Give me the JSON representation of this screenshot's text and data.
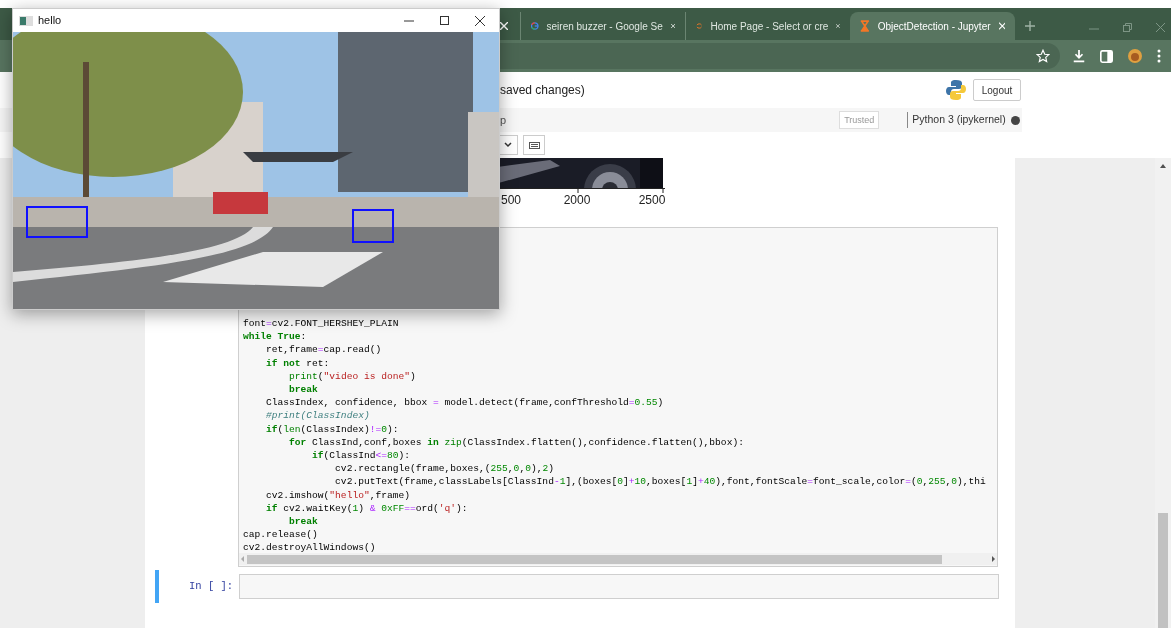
{
  "browser": {
    "tabs": [
      {
        "selected": false
      },
      {
        "title": "seiren buzzer - Google Se",
        "selected": false
      },
      {
        "title": "Home Page - Select or cre",
        "selected": false
      },
      {
        "title": "ObjectDetection - Jupyter",
        "selected": true
      }
    ]
  },
  "notebook": {
    "header_status": "saved changes)",
    "logout": "Logout",
    "menu_fragment": "p",
    "trusted": "Trusted",
    "kernel": "Python 3 (ipykernel)",
    "kernel_busy": true,
    "output_plot": {
      "tick_labels": [
        "500",
        "2000",
        "2500"
      ]
    },
    "code_cell": {
      "lines": [
        [
          {
            "kind": "plain",
            "text": "font"
          },
          {
            "kind": "operator",
            "text": "="
          },
          {
            "kind": "plain",
            "text": "cv2.FONT_HERSHEY_PLAIN"
          }
        ],
        [
          {
            "kind": "keyword",
            "text": "while True"
          },
          {
            "kind": "plain",
            "text": ":"
          }
        ],
        [
          {
            "kind": "plain",
            "text": "    ret,frame"
          },
          {
            "kind": "operator",
            "text": "="
          },
          {
            "kind": "plain",
            "text": "cap.read()"
          }
        ],
        [
          {
            "kind": "keyword",
            "text": "    if not"
          },
          {
            "kind": "plain",
            "text": " ret:"
          }
        ],
        [
          {
            "kind": "builtin",
            "text": "        print"
          },
          {
            "kind": "plain",
            "text": "("
          },
          {
            "kind": "string",
            "text": "\"video is done\""
          },
          {
            "kind": "plain",
            "text": ")"
          }
        ],
        [
          {
            "kind": "keyword",
            "text": "        break"
          }
        ],
        [
          {
            "kind": "plain",
            "text": "    ClassIndex, confidence, bbox "
          },
          {
            "kind": "operator",
            "text": "="
          },
          {
            "kind": "plain",
            "text": " model.detect(frame,confThreshold"
          },
          {
            "kind": "operator",
            "text": "="
          },
          {
            "kind": "number",
            "text": "0.55"
          },
          {
            "kind": "plain",
            "text": ")"
          }
        ],
        [
          {
            "kind": "comment",
            "text": "    #print(ClassIndex)"
          }
        ],
        [
          {
            "kind": "keyword",
            "text": "    if"
          },
          {
            "kind": "plain",
            "text": "("
          },
          {
            "kind": "builtin",
            "text": "len"
          },
          {
            "kind": "plain",
            "text": "(ClassIndex)"
          },
          {
            "kind": "operator",
            "text": "!="
          },
          {
            "kind": "number",
            "text": "0"
          },
          {
            "kind": "plain",
            "text": "):"
          }
        ],
        [
          {
            "kind": "keyword",
            "text": "        for"
          },
          {
            "kind": "plain",
            "text": " ClassInd,conf,boxes "
          },
          {
            "kind": "keyword",
            "text": "in"
          },
          {
            "kind": "builtin",
            "text": " zip"
          },
          {
            "kind": "plain",
            "text": "(ClassIndex.flatten(),confidence.flatten(),bbox):"
          }
        ],
        [
          {
            "kind": "keyword",
            "text": "            if"
          },
          {
            "kind": "plain",
            "text": "(ClassInd"
          },
          {
            "kind": "operator",
            "text": "<="
          },
          {
            "kind": "number",
            "text": "80"
          },
          {
            "kind": "plain",
            "text": "):"
          }
        ],
        [
          {
            "kind": "plain",
            "text": "                cv2.rectangle(frame,boxes,("
          },
          {
            "kind": "number",
            "text": "255"
          },
          {
            "kind": "plain",
            "text": ","
          },
          {
            "kind": "number",
            "text": "0"
          },
          {
            "kind": "plain",
            "text": ","
          },
          {
            "kind": "number",
            "text": "0"
          },
          {
            "kind": "plain",
            "text": "),"
          },
          {
            "kind": "number",
            "text": "2"
          },
          {
            "kind": "plain",
            "text": ")"
          }
        ],
        [
          {
            "kind": "plain",
            "text": "                cv2.putText(frame,classLabels[ClassInd"
          },
          {
            "kind": "operator",
            "text": "-"
          },
          {
            "kind": "number",
            "text": "1"
          },
          {
            "kind": "plain",
            "text": "],(boxes["
          },
          {
            "kind": "number",
            "text": "0"
          },
          {
            "kind": "plain",
            "text": "]"
          },
          {
            "kind": "operator",
            "text": "+"
          },
          {
            "kind": "number",
            "text": "10"
          },
          {
            "kind": "plain",
            "text": ",boxes["
          },
          {
            "kind": "number",
            "text": "1"
          },
          {
            "kind": "plain",
            "text": "]"
          },
          {
            "kind": "operator",
            "text": "+"
          },
          {
            "kind": "number",
            "text": "40"
          },
          {
            "kind": "plain",
            "text": "),font,fontScale"
          },
          {
            "kind": "operator",
            "text": "="
          },
          {
            "kind": "plain",
            "text": "font_scale,color"
          },
          {
            "kind": "operator",
            "text": "="
          },
          {
            "kind": "plain",
            "text": "("
          },
          {
            "kind": "number",
            "text": "0"
          },
          {
            "kind": "plain",
            "text": ","
          },
          {
            "kind": "number",
            "text": "255"
          },
          {
            "kind": "plain",
            "text": ","
          },
          {
            "kind": "number",
            "text": "0"
          },
          {
            "kind": "plain",
            "text": "),thi"
          }
        ],
        [
          {
            "kind": "plain",
            "text": "    cv2.imshow("
          },
          {
            "kind": "string",
            "text": "\"hello\""
          },
          {
            "kind": "plain",
            "text": ",frame)"
          }
        ],
        [
          {
            "kind": "keyword",
            "text": "    if"
          },
          {
            "kind": "plain",
            "text": " cv2.waitKey("
          },
          {
            "kind": "number",
            "text": "1"
          },
          {
            "kind": "plain",
            "text": ") "
          },
          {
            "kind": "operator",
            "text": "&"
          },
          {
            "kind": "number",
            "text": " 0xFF"
          },
          {
            "kind": "operator",
            "text": "=="
          },
          {
            "kind": "plain",
            "text": "ord("
          },
          {
            "kind": "string",
            "text": "'q'"
          },
          {
            "kind": "plain",
            "text": "):"
          }
        ],
        [
          {
            "kind": "keyword",
            "text": "        break"
          }
        ],
        [
          {
            "kind": "plain",
            "text": "cap.release()"
          }
        ],
        [
          {
            "kind": "plain",
            "text": "cv2.destroyAllWindows()"
          }
        ]
      ]
    },
    "empty_cell": {
      "prompt": "In [ ]:",
      "selected": true
    }
  },
  "popup": {
    "title": "hello"
  }
}
